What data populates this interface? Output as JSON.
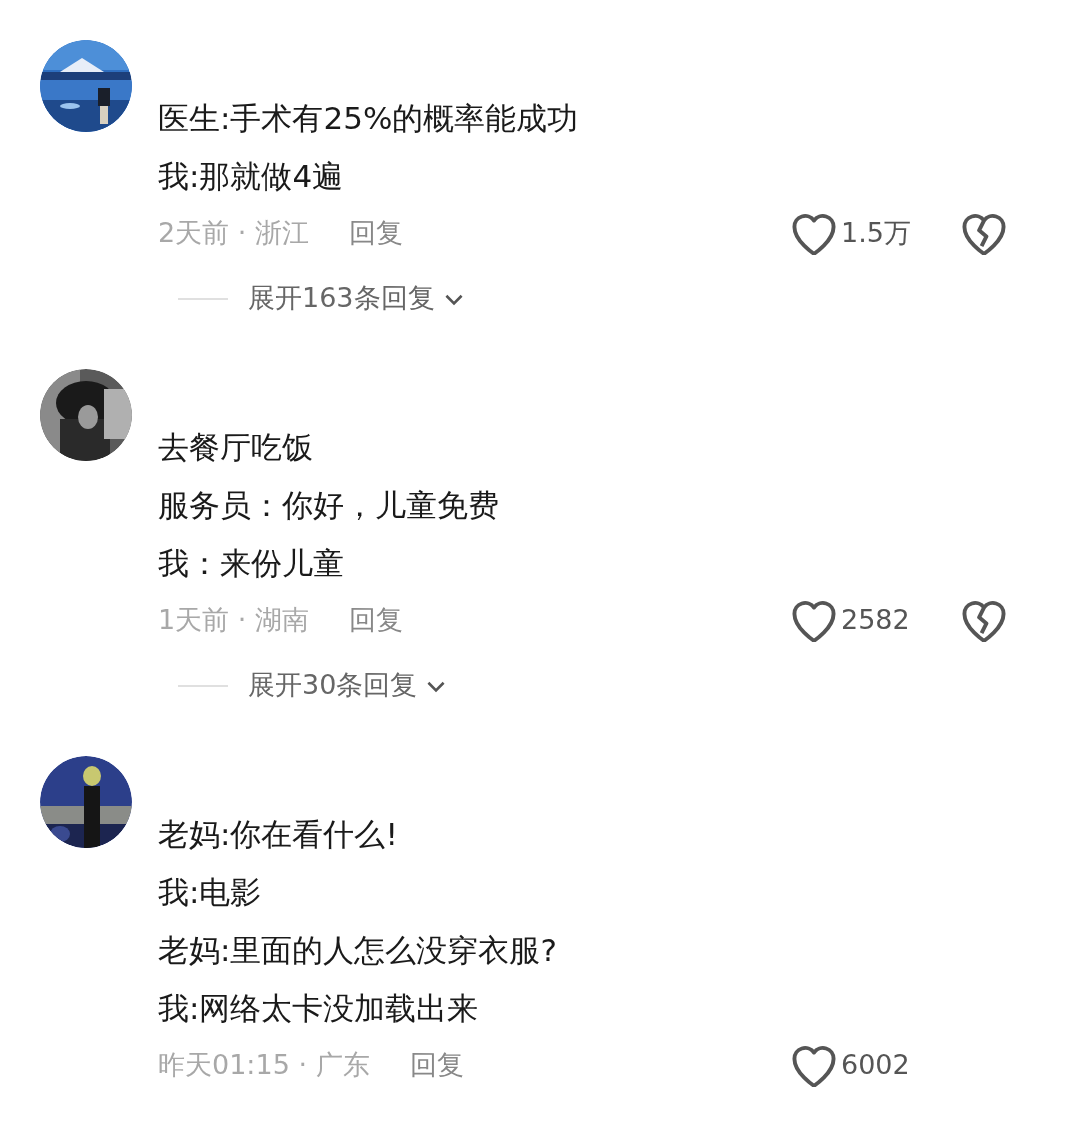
{
  "comments": [
    {
      "avatar": {
        "kind": "picture"
      },
      "lines": [
        "医生:手术有25%的概率能成功",
        "我:那就做4遍"
      ],
      "time_place": "2天前 · 浙江",
      "reply": "回复",
      "likes": "1.5万",
      "dislike_icon": true,
      "expand": "展开163条回复"
    },
    {
      "avatar": {
        "kind": "picture"
      },
      "lines": [
        "去餐厅吃饭",
        "服务员：你好，儿童免费",
        "我：来份儿童"
      ],
      "time_place": "1天前 · 湖南",
      "reply": "回复",
      "likes": "2582",
      "dislike_icon": true,
      "expand": "展开30条回复"
    },
    {
      "avatar": {
        "kind": "picture"
      },
      "lines": [
        "老妈:你在看什么!",
        "我:电影",
        "老妈:里面的人怎么没穿衣服?",
        "我:网络太卡没加载出来"
      ],
      "time_place": "昨天01:15 · 广东",
      "reply": "回复",
      "likes": "6002",
      "dislike_icon": false
    }
  ]
}
